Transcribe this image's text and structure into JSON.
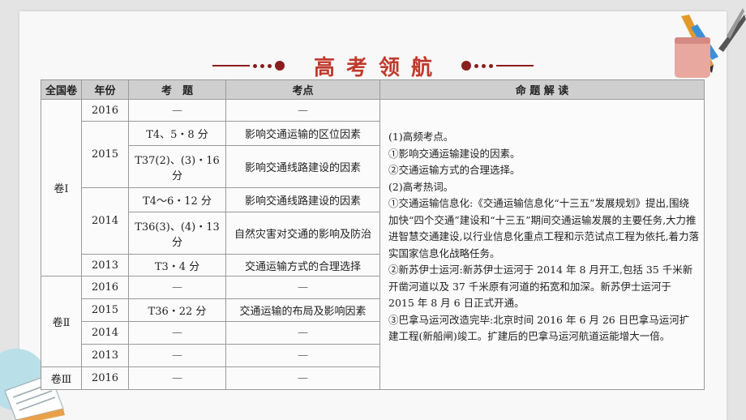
{
  "title": "高考领航",
  "headers": [
    "全国卷",
    "年份",
    "考　题",
    "考点",
    "命 题 解 读"
  ],
  "groups": [
    {
      "label": "卷Ⅰ",
      "rows": [
        {
          "year": "2016",
          "question": "—",
          "point": "—"
        },
        {
          "year": "2015",
          "question": "T4、5・8 分",
          "point": "影响交通运输的区位因素"
        },
        {
          "year": "",
          "question": "T37(2)、(3)・16 分",
          "point": "影响交通线路建设的因素"
        },
        {
          "year": "2014",
          "question": "T4～6・12 分",
          "point": "影响交通线路建设的因素"
        },
        {
          "year": "",
          "question": "T36(3)、(4)・13 分",
          "point": "自然灾害对交通的影响及防治"
        },
        {
          "year": "2013",
          "question": "T3・4 分",
          "point": "交通运输方式的合理选择"
        }
      ]
    },
    {
      "label": "卷Ⅱ",
      "rows": [
        {
          "year": "2016",
          "question": "—",
          "point": "—"
        },
        {
          "year": "2015",
          "question": "T36・22 分",
          "point": "交通运输的布局及影响因素"
        },
        {
          "year": "2014",
          "question": "—",
          "point": "—"
        },
        {
          "year": "2013",
          "question": "—",
          "point": "—"
        }
      ]
    },
    {
      "label": "卷Ⅲ",
      "rows": [
        {
          "year": "2016",
          "question": "—",
          "point": "—"
        }
      ]
    }
  ],
  "explanation": [
    "(1)高频考点。",
    "①影响交通运输建设的因素。",
    "②交通运输方式的合理选择。",
    "(2)高考热词。",
    "①交通运输信息化:《交通运输信息化“十三五”发展规划》提出,围绕加快“四个交通”建设和“十三五”期间交通运输发展的主要任务,大力推进智慧交通建设,以行业信息化重点工程和示范试点工程为依托,着力落实国家信息化战略任务。",
    "②新苏伊士运河:新苏伊士运河于 2014 年 8 月开工,包括 35 千米新开凿河道以及 37 千米原有河道的拓宽和加深。新苏伊士运河于 2015 年 8 月 6 日正式开通。",
    "③巴拿马运河改造完毕:北京时间 2016 年 6 月 26 日巴拿马运河扩建工程(新船闸)竣工。扩建后的巴拿马运河航道运能增大一倍。"
  ]
}
